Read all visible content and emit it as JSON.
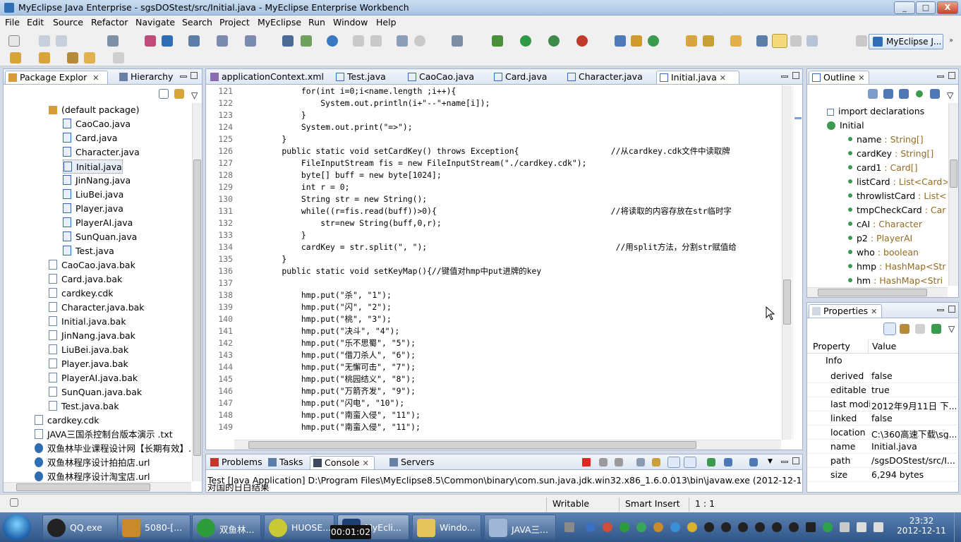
{
  "window": {
    "title": "MyEclipse Java Enterprise - sgsDOStest/src/Initial.java - MyEclipse Enterprise Workbench",
    "minimize": "_",
    "maximize": "□",
    "close": "X"
  },
  "menu": [
    "File",
    "Edit",
    "Source",
    "Refactor",
    "Navigate",
    "Search",
    "Project",
    "MyEclipse",
    "Run",
    "Window",
    "Help"
  ],
  "perspective": "MyEclipse J...",
  "left_panel": {
    "tabs": [
      "Package Explor",
      "Hierarchy"
    ],
    "items": [
      "(default package)",
      "CaoCao.java",
      "Card.java",
      "Character.java",
      "Initial.java",
      "JinNang.java",
      "LiuBei.java",
      "Player.java",
      "PlayerAI.java",
      "SunQuan.java",
      "Test.java",
      "CaoCao.java.bak",
      "Card.java.bak",
      "cardkey.cdk",
      "Character.java.bak",
      "Initial.java.bak",
      "JinNang.java.bak",
      "LiuBei.java.bak",
      "Player.java.bak",
      "PlayerAI.java.bak",
      "SunQuan.java.bak",
      "Test.java.bak",
      "cardkey.cdk",
      "JAVA三国杀控制台版本演示 .txt",
      "双鱼林毕业课程设计网【长期有效】.u",
      "双鱼林程序设计拍拍店.url",
      "双鱼林程序设计淘宝店.url"
    ]
  },
  "editor": {
    "tabs": [
      "applicationContext.xml",
      "Test.java",
      "CaoCao.java",
      "Card.java",
      "Character.java",
      "Initial.java"
    ],
    "active_tab": "Initial.java",
    "lines": [
      {
        "n": "121",
        "text": "        for(int i=0;i<name.length ;i++){"
      },
      {
        "n": "122",
        "text": "            System.out.println(i+\"--\"+name[i]);"
      },
      {
        "n": "123",
        "text": "        }"
      },
      {
        "n": "124",
        "text": "        System.out.print(\"=>\");"
      },
      {
        "n": "125",
        "text": "    }"
      },
      {
        "n": "126",
        "text": "    public static void setCardKey() throws Exception{                   //从cardkey.cdk文件中读取牌"
      },
      {
        "n": "127",
        "text": "        FileInputStream fis = new FileInputStream(\"./cardkey.cdk\");"
      },
      {
        "n": "128",
        "text": "        byte[] buff = new byte[1024];"
      },
      {
        "n": "129",
        "text": "        int r = 0;"
      },
      {
        "n": "130",
        "text": "        String str = new String();"
      },
      {
        "n": "131",
        "text": "        while((r=fis.read(buff))>0){                                    //将读取的内容存放在str临时字"
      },
      {
        "n": "132",
        "text": "            str=new String(buff,0,r);"
      },
      {
        "n": "133",
        "text": "        }"
      },
      {
        "n": "134",
        "text": "        cardKey = str.split(\", \");                                       //用split方法，分割str赋值给"
      },
      {
        "n": "135",
        "text": "    }"
      },
      {
        "n": "136",
        "text": "    public static void setKeyMap(){//键值对hmp中put进牌的key"
      },
      {
        "n": "137",
        "text": ""
      },
      {
        "n": "138",
        "text": "        hmp.put(\"杀\", \"1\");"
      },
      {
        "n": "139",
        "text": "        hmp.put(\"闪\", \"2\");"
      },
      {
        "n": "140",
        "text": "        hmp.put(\"桃\", \"3\");"
      },
      {
        "n": "141",
        "text": "        hmp.put(\"决斗\", \"4\");"
      },
      {
        "n": "142",
        "text": "        hmp.put(\"乐不思蜀\", \"5\");"
      },
      {
        "n": "143",
        "text": "        hmp.put(\"借刀杀人\", \"6\");"
      },
      {
        "n": "144",
        "text": "        hmp.put(\"无懈可击\", \"7\");"
      },
      {
        "n": "145",
        "text": "        hmp.put(\"桃园结义\", \"8\");"
      },
      {
        "n": "146",
        "text": "        hmp.put(\"万箭齐发\", \"9\");"
      },
      {
        "n": "147",
        "text": "        hmp.put(\"闪电\", \"10\");"
      },
      {
        "n": "148",
        "text": "        hmp.put(\"南蛮入侵\", \"11\");"
      },
      {
        "n": "149",
        "text": "        hmp.put(\"南蛮入侵\", \"11\");"
      }
    ]
  },
  "outline": {
    "tab": "Outline",
    "items": [
      {
        "name": "import declarations",
        "type": ""
      },
      {
        "name": "Initial",
        "type": ""
      },
      {
        "name": "name",
        "type": " : String[]"
      },
      {
        "name": "cardKey",
        "type": " : String[]"
      },
      {
        "name": "card1",
        "type": " : Card[]"
      },
      {
        "name": "listCard",
        "type": " : List<Card>"
      },
      {
        "name": "throwlistCard",
        "type": " : List<"
      },
      {
        "name": "tmpCheckCard",
        "type": " : Car"
      },
      {
        "name": "cAI",
        "type": " : Character"
      },
      {
        "name": "p2",
        "type": " : PlayerAI"
      },
      {
        "name": "who",
        "type": " : boolean"
      },
      {
        "name": "hmp",
        "type": " : HashMap<Str"
      },
      {
        "name": "hm",
        "type": " : HashMap<Stri"
      }
    ]
  },
  "properties": {
    "tab": "Properties",
    "col_property": "Property",
    "col_value": "Value",
    "group": "Info",
    "rows": [
      {
        "k": "derived",
        "v": "false"
      },
      {
        "k": "editable",
        "v": "true"
      },
      {
        "k": "last modified",
        "v": "2012年9月11日 下..."
      },
      {
        "k": "linked",
        "v": "false"
      },
      {
        "k": "location",
        "v": "C:\\360高速下载\\sg..."
      },
      {
        "k": "name",
        "v": "Initial.java"
      },
      {
        "k": "path",
        "v": "/sgsDOStest/src/I..."
      },
      {
        "k": "size",
        "v": "6,294  bytes"
      }
    ]
  },
  "console": {
    "tabs": [
      "Problems",
      "Tasks",
      "Console",
      "Servers"
    ],
    "header": "Test [Java Application] D:\\Program Files\\MyEclipse8.5\\Common\\binary\\com.sun.java.jdk.win32.x86_1.6.0.013\\bin\\javaw.exe (2012-12-11 下午11:20:",
    "output": "对国的日白结果"
  },
  "status": {
    "writable": "Writable",
    "insert": "Smart Insert",
    "position": "1 : 1"
  },
  "taskbar": {
    "buttons": [
      "QQ.exe",
      "5080-[...",
      "双鱼林...",
      "HUOSE...",
      "MyEcli...",
      "Windo...",
      "JAVA三..."
    ],
    "recording": "00:01:02",
    "time": "23:32",
    "date": "2012-12-11"
  }
}
